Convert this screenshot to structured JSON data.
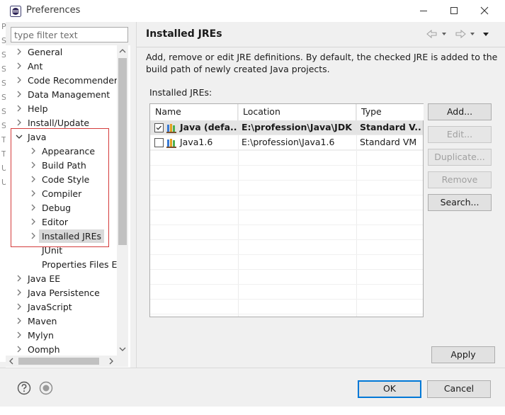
{
  "window": {
    "title": "Preferences"
  },
  "left_edge_glyphs": [
    "P",
    "S",
    "S",
    "S",
    "S",
    "S",
    "S",
    "S",
    "T",
    "T",
    "U",
    "U"
  ],
  "filter": {
    "placeholder": "type filter text"
  },
  "tree": {
    "items": [
      {
        "label": "General",
        "expandable": true,
        "level": 0
      },
      {
        "label": "Ant",
        "expandable": true,
        "level": 0
      },
      {
        "label": "Code Recommenders",
        "expandable": true,
        "level": 0
      },
      {
        "label": "Data Management",
        "expandable": true,
        "level": 0
      },
      {
        "label": "Help",
        "expandable": true,
        "level": 0
      },
      {
        "label": "Install/Update",
        "expandable": true,
        "level": 0
      },
      {
        "label": "Java",
        "expandable": true,
        "expanded": true,
        "level": 0
      },
      {
        "label": "Appearance",
        "expandable": true,
        "level": 1
      },
      {
        "label": "Build Path",
        "expandable": true,
        "level": 1
      },
      {
        "label": "Code Style",
        "expandable": true,
        "level": 1
      },
      {
        "label": "Compiler",
        "expandable": true,
        "level": 1
      },
      {
        "label": "Debug",
        "expandable": true,
        "level": 1
      },
      {
        "label": "Editor",
        "expandable": true,
        "level": 1
      },
      {
        "label": "Installed JREs",
        "expandable": true,
        "level": 1,
        "selected": true
      },
      {
        "label": "JUnit",
        "expandable": false,
        "level": 1
      },
      {
        "label": "Properties Files Ed",
        "expandable": false,
        "level": 1
      },
      {
        "label": "Java EE",
        "expandable": true,
        "level": 0
      },
      {
        "label": "Java Persistence",
        "expandable": true,
        "level": 0
      },
      {
        "label": "JavaScript",
        "expandable": true,
        "level": 0
      },
      {
        "label": "Maven",
        "expandable": true,
        "level": 0
      },
      {
        "label": "Mylyn",
        "expandable": true,
        "level": 0
      },
      {
        "label": "Oomph",
        "expandable": true,
        "level": 0
      }
    ]
  },
  "page": {
    "title": "Installed JREs",
    "description_line1": "Add, remove or edit JRE definitions. By default, the checked JRE is added to the",
    "description_line2": "build path of newly created Java projects.",
    "list_label": "Installed JREs:"
  },
  "table": {
    "columns": [
      "Name",
      "Location",
      "Type"
    ],
    "rows": [
      {
        "checked": true,
        "name": "Java (defa...",
        "location": "E:\\profession\\Java\\JDK",
        "type": "Standard V...",
        "bold": true
      },
      {
        "checked": false,
        "name": "Java1.6",
        "location": "E:\\profession\\Java1.6",
        "type": "Standard VM",
        "bold": false
      }
    ]
  },
  "buttons": {
    "add": "Add...",
    "edit": "Edit...",
    "duplicate": "Duplicate...",
    "remove": "Remove",
    "search": "Search...",
    "apply": "Apply",
    "ok": "OK",
    "cancel": "Cancel"
  },
  "colors": {
    "highlight_box": "#d43c3c",
    "default_button_border": "#0078d7"
  }
}
